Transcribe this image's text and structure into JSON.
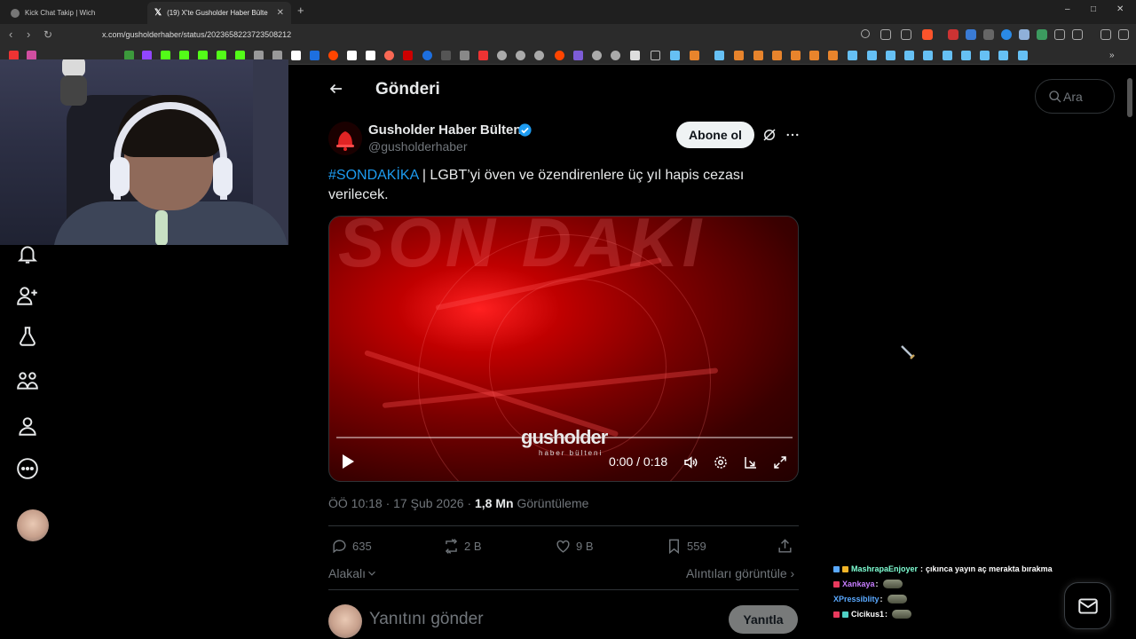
{
  "browser": {
    "tabs": [
      {
        "title": "Kick Chat Takip | Wich",
        "active": false
      },
      {
        "title": "(19) X'te Gusholder Haber Bülte",
        "active": true
      }
    ],
    "url": "x.com/gusholderhaber/status/2023658223723508212",
    "window_controls": [
      "–",
      "□",
      "✕"
    ]
  },
  "x": {
    "header": {
      "title": "Gönderi"
    },
    "author": {
      "name": "Gusholder Haber Bülteni",
      "handle": "@gusholderhaber",
      "follow_label": "Abone ol"
    },
    "tweet": {
      "hashtag": "#SONDAKİKA",
      "text": " | LGBT’yi öven ve özendirenlere üç yıl hapis cezası verilecek."
    },
    "video": {
      "banner_text": "SON DAKİ",
      "logo": "gusholder",
      "logo_sub": "haber bülteni",
      "time": "0:00 / 0:18"
    },
    "meta": {
      "time": "ÖÖ 10:18 · 17 Şub 2026 · ",
      "views": "1,8 Mn",
      "views_label": " Görüntüleme"
    },
    "actions": {
      "replies": "635",
      "reposts": "2 B",
      "likes": "9 B",
      "bookmarks": "559"
    },
    "related_label": "Alakalı",
    "view_quotes_label": "Alıntıları görüntüle ›",
    "reply": {
      "placeholder": "Yanıtını gönder",
      "button": "Yanıtla"
    },
    "search": {
      "placeholder": "Ara"
    }
  },
  "chat": [
    {
      "user": "MashrapaEnjoyer",
      "message": "çıkınca yayın aç merakta bırakma",
      "color": "#7fffd4",
      "emote": false
    },
    {
      "user": "Xankaya",
      "message": "",
      "color": "#c77dff",
      "emote": true
    },
    {
      "user": "XPressiblity",
      "message": "",
      "color": "#5aa9ff",
      "emote": true
    },
    {
      "user": "Cicikus1",
      "message": "",
      "color": "#ffffff",
      "emote": true
    }
  ],
  "colors": {
    "accent": "#1d9bf0",
    "background": "#000000",
    "muted": "#71767b",
    "text": "#e7e9ea"
  }
}
